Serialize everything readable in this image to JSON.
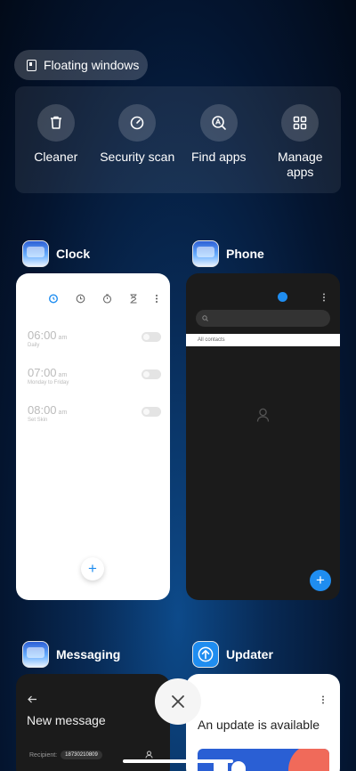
{
  "floating_windows": {
    "label": "Floating windows"
  },
  "quick_actions": [
    {
      "label": "Cleaner",
      "icon": "trash-icon"
    },
    {
      "label": "Security scan",
      "icon": "security-scan-icon"
    },
    {
      "label": "Find apps",
      "icon": "find-apps-icon"
    },
    {
      "label": "Manage apps",
      "icon": "grid-icon"
    }
  ],
  "apps": {
    "clock": {
      "name": "Clock",
      "alarms": [
        {
          "time": "06:00",
          "ampm": "am",
          "repeat": "Daily"
        },
        {
          "time": "07:00",
          "ampm": "am",
          "repeat": "Monday to Friday"
        },
        {
          "time": "08:00",
          "ampm": "am",
          "repeat": "Set Skin"
        }
      ],
      "add_label": "+"
    },
    "phone": {
      "name": "Phone",
      "search_placeholder": "",
      "tab_label": "All contacts",
      "add_label": "+"
    },
    "messaging": {
      "name": "Messaging",
      "title": "New message",
      "recipient_label": "Recipient:",
      "recipient_value": "18730210809"
    },
    "updater": {
      "name": "Updater",
      "heading": "An update is available"
    }
  },
  "colors": {
    "accent_blue": "#1f8df0",
    "card_dark": "#1b1b1b",
    "card_light": "#ffffff"
  }
}
